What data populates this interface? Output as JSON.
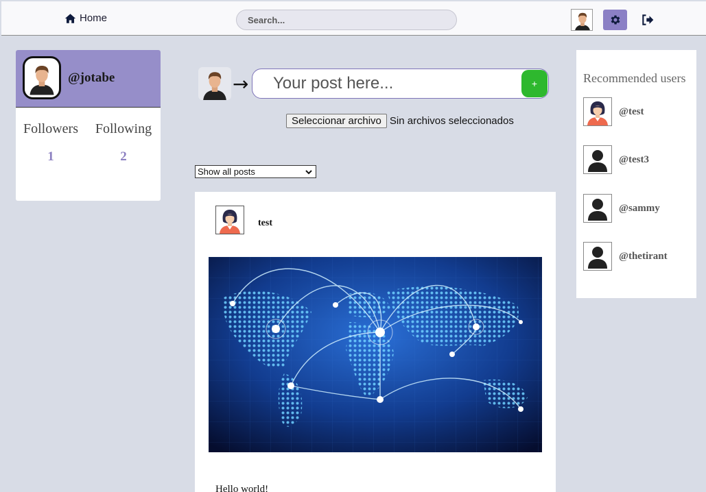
{
  "navbar": {
    "home_label": "Home",
    "search_placeholder": "Search...",
    "icons": {
      "home": "home-icon",
      "settings": "gear-icon",
      "logout": "logout-icon"
    },
    "accent_color": "#8b80c5"
  },
  "profile": {
    "handle": "@jotabe",
    "followers_label": "Followers",
    "followers_count": "1",
    "following_label": "Following",
    "following_count": "2"
  },
  "composer": {
    "placeholder": "Your post here...",
    "submit_label": "+",
    "file_button_label": "Seleccionar archivo",
    "file_status": "Sin archivos seleccionados"
  },
  "filter": {
    "selected": "Show all posts"
  },
  "post": {
    "author": "test",
    "text": "Hello world!",
    "image_subject": "world-network-map"
  },
  "recommended": {
    "title": "Recommended users",
    "users": [
      {
        "handle": "@test",
        "avatar": "female-avatar"
      },
      {
        "handle": "@test3",
        "avatar": "default-user-icon"
      },
      {
        "handle": "@sammy",
        "avatar": "default-user-icon"
      },
      {
        "handle": "@thetirant",
        "avatar": "default-user-icon"
      }
    ]
  },
  "colors": {
    "background": "#d8dce6",
    "profile_header": "#968ec9",
    "stat_value": "#8c80c1",
    "post_button": "#2eb82e"
  }
}
